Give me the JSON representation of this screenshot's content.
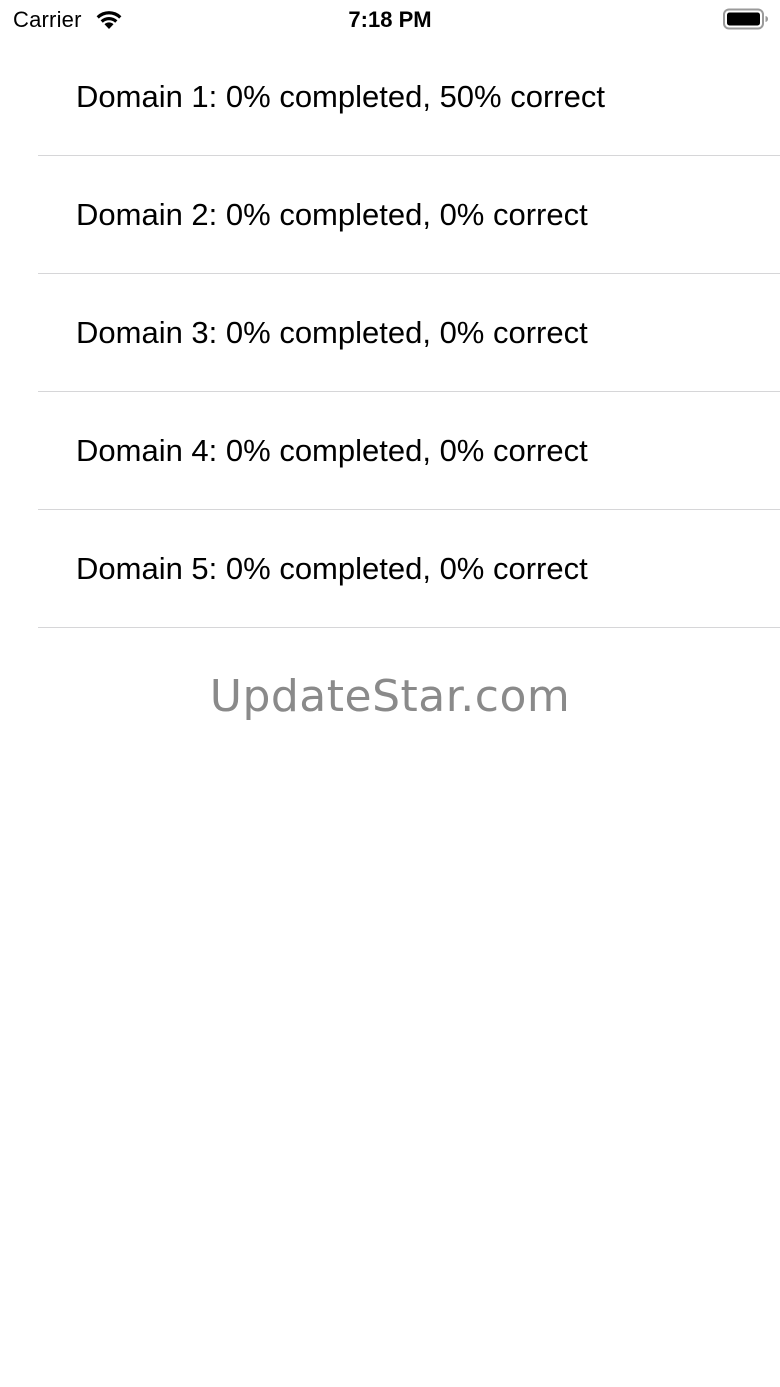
{
  "status_bar": {
    "carrier": "Carrier",
    "time": "7:18 PM",
    "icons": [
      "wifi-icon",
      "battery-icon"
    ]
  },
  "domains": [
    {
      "label": "Domain 1: 0% completed, 50% correct"
    },
    {
      "label": "Domain 2: 0% completed, 0% correct"
    },
    {
      "label": "Domain 3: 0% completed, 0% correct"
    },
    {
      "label": "Domain 4: 0% completed, 0% correct"
    },
    {
      "label": "Domain 5: 0% completed, 0% correct"
    }
  ],
  "watermark": "UpdateStar.com",
  "colors": {
    "background": "#ffffff",
    "separator": "#d6d6d8",
    "watermark": "#8a8a8a"
  }
}
